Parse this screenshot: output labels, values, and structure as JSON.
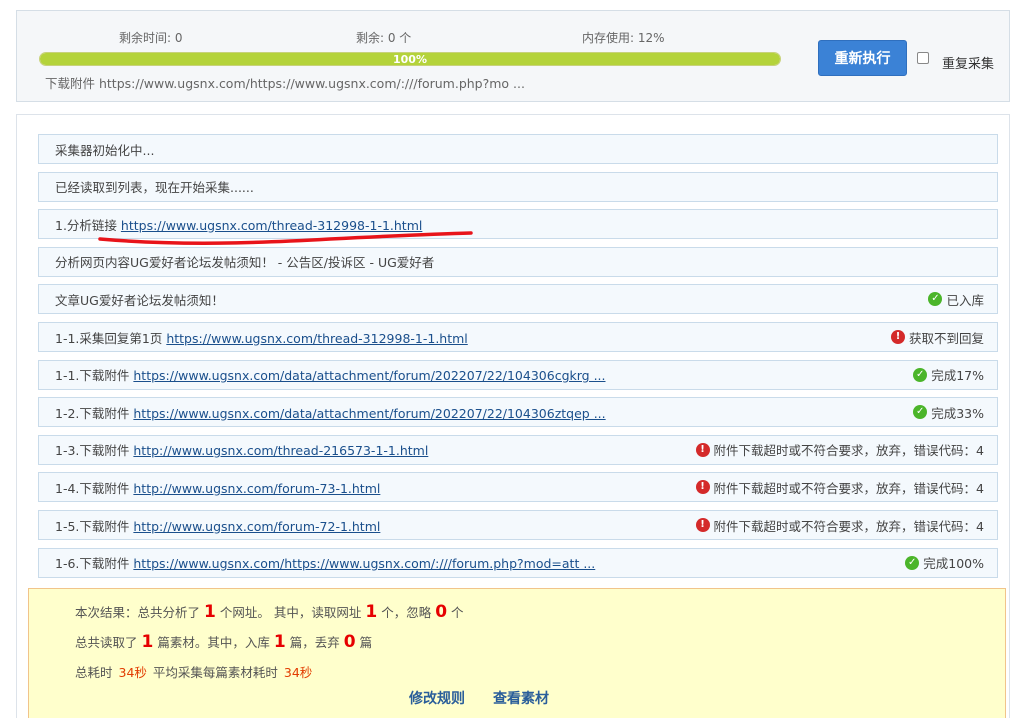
{
  "status": {
    "remaining_time_label": "剩余时间: 0",
    "remaining_count_label": "剩余: 0 个",
    "memory_label": "内存使用: 12%",
    "progress_value": 1.0,
    "progress_text": "100%",
    "download_line": "下载附件 https://www.ugsnx.com/https://www.ugsnx.com/:///forum.php?mo ...",
    "rerun_button": "重新执行",
    "repeat_label": "重复采集",
    "repeat_checked": false
  },
  "log": [
    {
      "prefix": "采集器初始化中...",
      "link": "",
      "status": "",
      "status_type": ""
    },
    {
      "prefix": "已经读取到列表，现在开始采集......",
      "link": "",
      "status": "",
      "status_type": ""
    },
    {
      "prefix": "1.分析链接 ",
      "link": "https://www.ugsnx.com/thread-312998-1-1.html",
      "status": "",
      "status_type": ""
    },
    {
      "prefix": "分析网页内容UG爱好者论坛发帖须知！ - 公告区/投诉区 - UG爱好者",
      "link": "",
      "status": "",
      "status_type": ""
    },
    {
      "prefix": "文章UG爱好者论坛发帖须知！",
      "link": "",
      "status": "已入库",
      "status_type": "ok"
    },
    {
      "prefix": "1-1.采集回复第1页 ",
      "link": "https://www.ugsnx.com/thread-312998-1-1.html",
      "status": "获取不到回复",
      "status_type": "err"
    },
    {
      "prefix": "1-1.下载附件 ",
      "link": "https://www.ugsnx.com/data/attachment/forum/202207/22/104306cgkrg ...",
      "status": "完成17%",
      "status_type": "ok"
    },
    {
      "prefix": "1-2.下载附件 ",
      "link": "https://www.ugsnx.com/data/attachment/forum/202207/22/104306ztqep ...",
      "status": "完成33%",
      "status_type": "ok"
    },
    {
      "prefix": "1-3.下载附件 ",
      "link": "http://www.ugsnx.com/thread-216573-1-1.html",
      "status": "附件下载超时或不符合要求，放弃，错误代码：4",
      "status_type": "err"
    },
    {
      "prefix": "1-4.下载附件 ",
      "link": "http://www.ugsnx.com/forum-73-1.html",
      "status": "附件下载超时或不符合要求，放弃，错误代码：4",
      "status_type": "err"
    },
    {
      "prefix": "1-5.下载附件 ",
      "link": "http://www.ugsnx.com/forum-72-1.html",
      "status": "附件下载超时或不符合要求，放弃，错误代码：4",
      "status_type": "err"
    },
    {
      "prefix": "1-6.下载附件 ",
      "link": "https://www.ugsnx.com/https://www.ugsnx.com/:///forum.php?mod=att ...",
      "status": "完成100%",
      "status_type": "ok"
    }
  ],
  "summary": {
    "line1": {
      "t1": "本次结果：总共分析了",
      "n1": "1",
      "t2": "个网址。 其中，读取网址",
      "n2": "1",
      "t3": "个，忽略",
      "n3": "0",
      "t4": "个"
    },
    "line2": {
      "t1": "总共读取了",
      "n1": "1",
      "t2": "篇素材。其中，入库",
      "n2": "1",
      "t3": "篇，丢弃",
      "n3": "0",
      "t4": "篇"
    },
    "line3": {
      "t1": "总耗时",
      "v1": "34秒",
      "t2": "平均采集每篇素材耗时",
      "v2": "34秒"
    },
    "edit_rules_link": "修改规则",
    "view_material_link": "查看素材"
  },
  "colors": {
    "progress_fill": "#b4d33a",
    "button_blue": "#3b82d6",
    "link": "#1a4f8c",
    "ok_icon": "#4bb52a",
    "error_icon": "#d42a2a",
    "summary_number": "#e60000",
    "annotation_stroke": "#e8141a"
  }
}
